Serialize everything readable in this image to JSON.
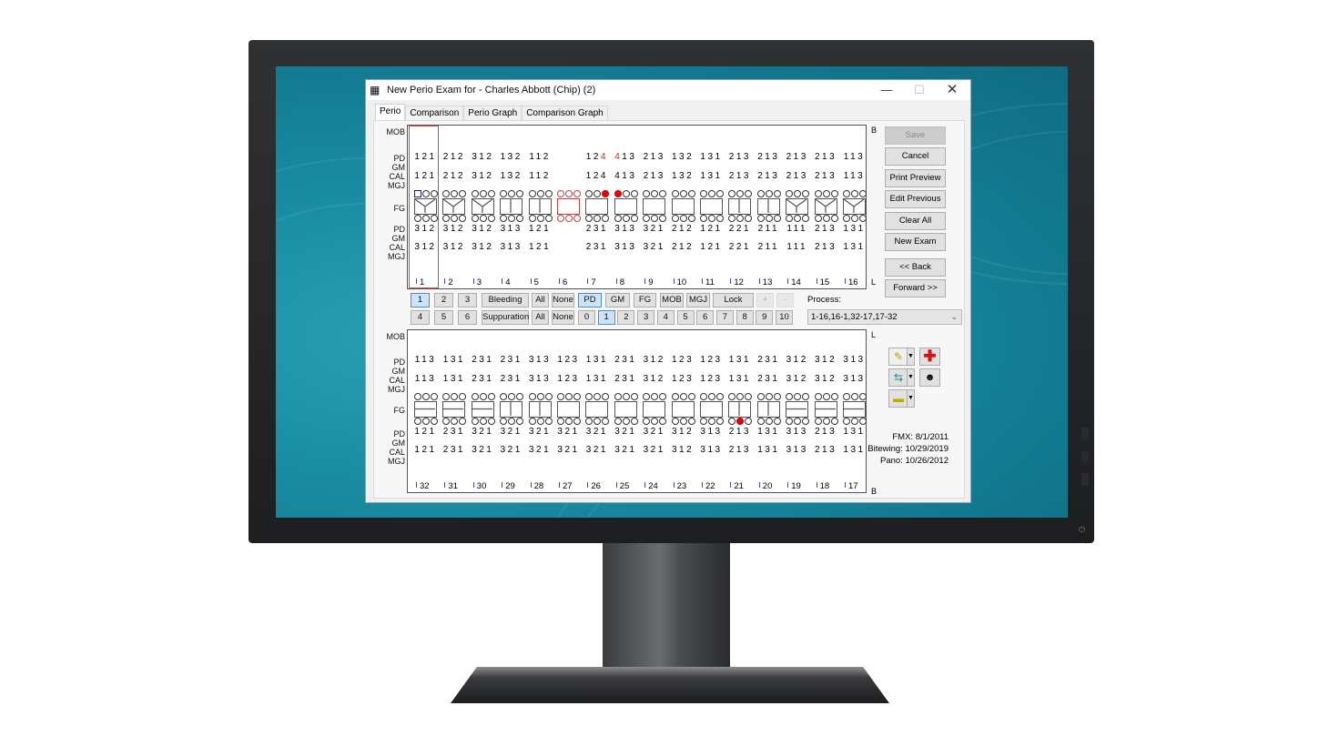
{
  "window": {
    "title": "New Perio Exam for - Charles Abbott (Chip) (2)",
    "minimize_icon": "minimize-icon",
    "maximize_icon": "maximize-icon",
    "close_icon": "close-icon"
  },
  "tabs": [
    {
      "label": "Perio",
      "active": true
    },
    {
      "label": "Comparison",
      "active": false
    },
    {
      "label": "Perio Graph",
      "active": false
    },
    {
      "label": "Comparison Graph",
      "active": false
    }
  ],
  "row_labels": {
    "mob": "MOB",
    "pd": "PD",
    "gm": "GM",
    "cal": "CAL",
    "mgj": "MGJ",
    "fg": "FG"
  },
  "corner_labels": {
    "upper_top": "B",
    "upper_bottom": "L",
    "lower_top": "L",
    "lower_bottom": "B"
  },
  "upper_arch": {
    "teeth": [
      {
        "id": "1",
        "buccal_pd": "121",
        "buccal_cal": "121",
        "lingual_pd": "312",
        "lingual_cal": "312",
        "furcation": "Y",
        "selected": true
      },
      {
        "id": "2",
        "buccal_pd": "212",
        "buccal_cal": "212",
        "lingual_pd": "312",
        "lingual_cal": "312",
        "furcation": "Y"
      },
      {
        "id": "3",
        "buccal_pd": "312",
        "buccal_cal": "312",
        "lingual_pd": "312",
        "lingual_cal": "312",
        "furcation": "Y"
      },
      {
        "id": "4",
        "buccal_pd": "132",
        "buccal_cal": "132",
        "lingual_pd": "313",
        "lingual_cal": "313",
        "furcation": "V"
      },
      {
        "id": "5",
        "buccal_pd": "112",
        "buccal_cal": "112",
        "lingual_pd": "121",
        "lingual_cal": "121",
        "furcation": "V"
      },
      {
        "id": "6",
        "buccal_pd": "",
        "buccal_cal": "",
        "lingual_pd": "",
        "lingual_cal": "",
        "furcation": "",
        "missing": true
      },
      {
        "id": "7",
        "buccal_pd": "124",
        "buccal_pd_red": [
          2
        ],
        "buccal_cal": "124",
        "lingual_pd": "231",
        "lingual_cal": "231",
        "furcation": "",
        "bleeding_buccal": [
          2
        ]
      },
      {
        "id": "8",
        "buccal_pd": "413",
        "buccal_pd_red": [
          0
        ],
        "buccal_cal": "413",
        "lingual_pd": "313",
        "lingual_cal": "313",
        "furcation": "",
        "bleeding_buccal": [
          0
        ]
      },
      {
        "id": "9",
        "buccal_pd": "213",
        "buccal_cal": "213",
        "lingual_pd": "321",
        "lingual_cal": "321",
        "furcation": ""
      },
      {
        "id": "10",
        "buccal_pd": "132",
        "buccal_cal": "132",
        "lingual_pd": "212",
        "lingual_cal": "212",
        "furcation": ""
      },
      {
        "id": "11",
        "buccal_pd": "131",
        "buccal_cal": "131",
        "lingual_pd": "121",
        "lingual_cal": "121",
        "furcation": ""
      },
      {
        "id": "12",
        "buccal_pd": "213",
        "buccal_cal": "213",
        "lingual_pd": "221",
        "lingual_cal": "221",
        "furcation": "V"
      },
      {
        "id": "13",
        "buccal_pd": "213",
        "buccal_cal": "213",
        "lingual_pd": "211",
        "lingual_cal": "211",
        "furcation": "V"
      },
      {
        "id": "14",
        "buccal_pd": "213",
        "buccal_cal": "213",
        "lingual_pd": "111",
        "lingual_cal": "111",
        "furcation": "Y"
      },
      {
        "id": "15",
        "buccal_pd": "213",
        "buccal_cal": "213",
        "lingual_pd": "213",
        "lingual_cal": "213",
        "furcation": "Y"
      },
      {
        "id": "16",
        "buccal_pd": "113",
        "buccal_cal": "113",
        "lingual_pd": "131",
        "lingual_cal": "131",
        "furcation": "Y"
      }
    ]
  },
  "lower_arch": {
    "teeth": [
      {
        "id": "32",
        "lingual_pd": "113",
        "lingual_cal": "113",
        "buccal_pd": "121",
        "buccal_cal": "121",
        "furcation": "H"
      },
      {
        "id": "31",
        "lingual_pd": "131",
        "lingual_cal": "131",
        "buccal_pd": "231",
        "buccal_cal": "231",
        "furcation": "H"
      },
      {
        "id": "30",
        "lingual_pd": "231",
        "lingual_cal": "231",
        "buccal_pd": "321",
        "buccal_cal": "321",
        "furcation": "H"
      },
      {
        "id": "29",
        "lingual_pd": "231",
        "lingual_cal": "231",
        "buccal_pd": "321",
        "buccal_cal": "321",
        "furcation": "V"
      },
      {
        "id": "28",
        "lingual_pd": "313",
        "lingual_cal": "313",
        "buccal_pd": "321",
        "buccal_cal": "321",
        "furcation": "V"
      },
      {
        "id": "27",
        "lingual_pd": "123",
        "lingual_cal": "123",
        "buccal_pd": "321",
        "buccal_cal": "321",
        "furcation": ""
      },
      {
        "id": "26",
        "lingual_pd": "131",
        "lingual_cal": "131",
        "buccal_pd": "321",
        "buccal_cal": "321",
        "furcation": ""
      },
      {
        "id": "25",
        "lingual_pd": "231",
        "lingual_cal": "231",
        "buccal_pd": "321",
        "buccal_cal": "321",
        "furcation": ""
      },
      {
        "id": "24",
        "lingual_pd": "312",
        "lingual_cal": "312",
        "buccal_pd": "321",
        "buccal_cal": "321",
        "furcation": ""
      },
      {
        "id": "23",
        "lingual_pd": "123",
        "lingual_cal": "123",
        "buccal_pd": "312",
        "buccal_cal": "312",
        "furcation": ""
      },
      {
        "id": "22",
        "lingual_pd": "123",
        "lingual_cal": "123",
        "buccal_pd": "313",
        "buccal_cal": "313",
        "furcation": ""
      },
      {
        "id": "21",
        "lingual_pd": "131",
        "lingual_cal": "131",
        "buccal_pd": "213",
        "buccal_cal": "213",
        "furcation": "V",
        "bleeding_buccal": [
          1
        ]
      },
      {
        "id": "20",
        "lingual_pd": "231",
        "lingual_cal": "231",
        "buccal_pd": "131",
        "buccal_cal": "131",
        "furcation": "V"
      },
      {
        "id": "19",
        "lingual_pd": "312",
        "lingual_cal": "312",
        "buccal_pd": "313",
        "buccal_cal": "313",
        "furcation": "H"
      },
      {
        "id": "18",
        "lingual_pd": "312",
        "lingual_cal": "312",
        "buccal_pd": "213",
        "buccal_cal": "213",
        "furcation": "H"
      },
      {
        "id": "17",
        "lingual_pd": "313",
        "lingual_cal": "313",
        "buccal_pd": "131",
        "buccal_cal": "131",
        "furcation": "H"
      }
    ]
  },
  "controls": {
    "row1": {
      "sites": [
        "1",
        "2",
        "3"
      ],
      "bleeding": "Bleeding",
      "bleeding_all": "All",
      "bleeding_none": "None",
      "modes": [
        "PD",
        "GM",
        "FG",
        "MOB",
        "MGJ"
      ],
      "active_mode": "PD",
      "lock": "Lock",
      "plus": "+",
      "minus": "-"
    },
    "row2": {
      "sites": [
        "4",
        "5",
        "6"
      ],
      "suppuration": "Suppuration",
      "suppuration_all": "All",
      "suppuration_none": "None",
      "values": [
        "0",
        "1",
        "2",
        "3",
        "4",
        "5",
        "6",
        "7",
        "8",
        "9",
        "10"
      ],
      "active_value": "1"
    },
    "active_site": "1",
    "process_label": "Process:",
    "process_value": "1-16,16-1,32-17,17-32"
  },
  "side_buttons": {
    "save": "Save",
    "cancel": "Cancel",
    "print_preview": "Print Preview",
    "edit_previous": "Edit Previous",
    "clear_all": "Clear All",
    "new_exam": "New Exam",
    "back": "<< Back",
    "forward": "Forward >>"
  },
  "imaging": {
    "icons": [
      "notes-icon",
      "medical-cross-icon",
      "transfer-icon",
      "patient-icon",
      "folder-icon"
    ]
  },
  "xray_dates": {
    "fmx_label": "FMX:",
    "fmx": "8/1/2011",
    "bitewing_label": "Bitewing:",
    "bitewing": "10/29/2019",
    "pano_label": "Pano:",
    "pano": "10/26/2012"
  },
  "colors": {
    "desktop": "#1a8ea3",
    "bleeding": "#e00000",
    "missing_tooth": "#d04040",
    "selected": "#cce4f7"
  }
}
